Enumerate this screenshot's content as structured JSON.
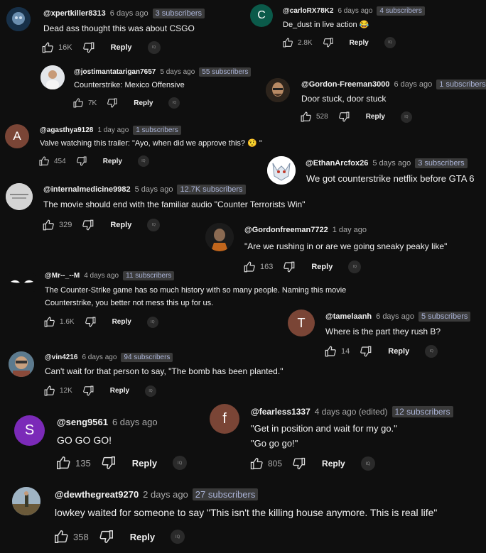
{
  "reply_label": "Reply",
  "badge_glyph": "IQ",
  "comments": [
    {
      "handle": "@xpertkiller8313",
      "time": "6 days ago",
      "subs": "3 subscribers",
      "text": "Dead ass thought this was about CSGO",
      "likes": "16K"
    },
    {
      "handle": "@carloRX78K2",
      "time": "6 days ago",
      "subs": "4 subscribers",
      "text": "De_dust in live action 😂",
      "likes": "2.8K",
      "avatar_letter": "C"
    },
    {
      "handle": "@jostimantatarigan7657",
      "time": "5 days ago",
      "subs": "55 subscribers",
      "text": "Counterstrike: Mexico Offensive",
      "likes": "7K"
    },
    {
      "handle": "@Gordon-Freeman3000",
      "time": "6 days ago",
      "subs": "1 subscribers",
      "text": "Door stuck, door stuck",
      "likes": "528"
    },
    {
      "handle": "@agasthya9128",
      "time": "1 day ago",
      "subs": "1 subscribers",
      "text": "Valve watching this trailer: \"Ayo, when did we approve this? 🤨 \"",
      "likes": "454",
      "avatar_letter": "A"
    },
    {
      "handle": "@EthanArcfox26",
      "time": "5 days ago",
      "subs": "3 subscribers",
      "text": "We got counterstrike netflix before GTA 6",
      "likes": ""
    },
    {
      "handle": "@internalmedicine9982",
      "time": "5 days ago",
      "subs": "12.7K subscribers",
      "text": "The movie should end with the familiar audio \"Counter Terrorists Win\"",
      "likes": "329"
    },
    {
      "handle": "@Gordonfreeman7722",
      "time": "1 day ago",
      "subs": "",
      "text": "\"Are we rushing in or are we going sneaky peaky like\"",
      "likes": "163"
    },
    {
      "handle": "@Mr--_--M",
      "time": "4 days ago",
      "subs": "11 subscribers",
      "text": "The Counter-Strike game has so much history with so many people. Naming this movie",
      "text2": "Counterstrike, you better not mess this up for us.",
      "likes": "1.6K"
    },
    {
      "handle": "@tamelaanh",
      "time": "6 days ago",
      "subs": "5 subscribers",
      "text": "Where is the part they rush B?",
      "likes": "14",
      "avatar_letter": "T"
    },
    {
      "handle": "@vin4216",
      "time": "6 days ago",
      "subs": "94 subscribers",
      "text": "Can't wait for that person to say, \"The bomb has been planted.\"",
      "likes": "12K"
    },
    {
      "handle": "@seng9561",
      "time": "6 days ago",
      "subs": "",
      "text": "GO GO GO!",
      "likes": "135",
      "avatar_letter": "S"
    },
    {
      "handle": "@fearless1337",
      "time": "4 days ago (edited)",
      "subs": "12 subscribers",
      "text": "\"Get in position and wait for my go.\"",
      "text2": "\"Go go go!\"",
      "likes": "805",
      "avatar_letter": "f"
    },
    {
      "handle": "@dewthegreat9270",
      "time": "2 days ago",
      "subs": "27 subscribers",
      "text": "lowkey waited for someone to say \"This isn't the killing house anymore. This is real life\"",
      "likes": "358"
    }
  ]
}
